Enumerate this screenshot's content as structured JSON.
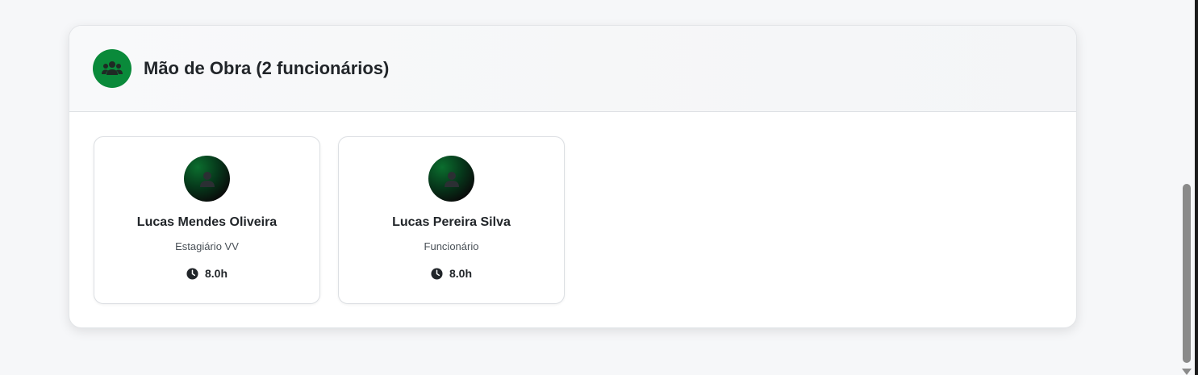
{
  "section": {
    "title": "Mão de Obra (2 funcionários)",
    "icon": "users-group-icon",
    "accent_color": "#0a8a3a"
  },
  "workers": [
    {
      "name": "Lucas Mendes Oliveira",
      "role": "Estagiário VV",
      "hours": "8.0h",
      "avatar_icon": "user-icon",
      "hours_icon": "clock-icon"
    },
    {
      "name": "Lucas Pereira Silva",
      "role": "Funcionário",
      "hours": "8.0h",
      "avatar_icon": "user-icon",
      "hours_icon": "clock-icon"
    }
  ]
}
